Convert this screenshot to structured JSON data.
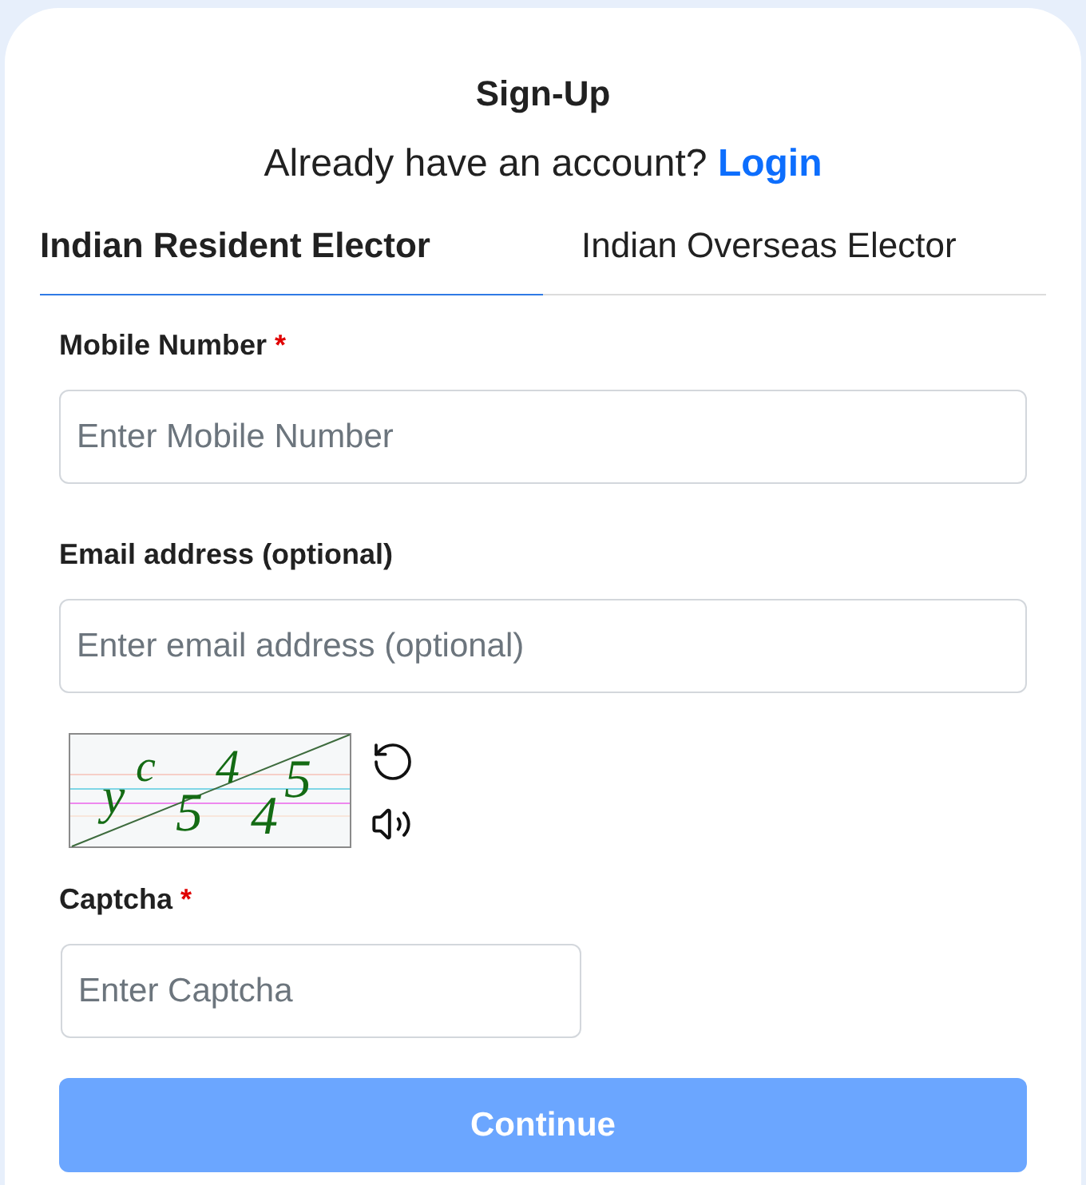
{
  "header": {
    "title": "Sign-Up",
    "prompt": "Already have an account?",
    "link": "Login"
  },
  "tabs": [
    {
      "label": "Indian Resident Elector",
      "selected": true
    },
    {
      "label": "Indian Overseas Elector",
      "selected": false
    }
  ],
  "fields": [
    {
      "label": "Mobile Number",
      "required_mark": "*",
      "placeholder": "Enter Mobile Number"
    },
    {
      "label": "Email address (optional)",
      "placeholder": "Enter email address (optional)"
    }
  ],
  "captcha": {
    "image_text": "yc5445",
    "label": "Captcha",
    "required_mark": "*",
    "placeholder": "Enter Captcha"
  },
  "continue_button": {
    "label": "Continue",
    "disabled": true
  }
}
